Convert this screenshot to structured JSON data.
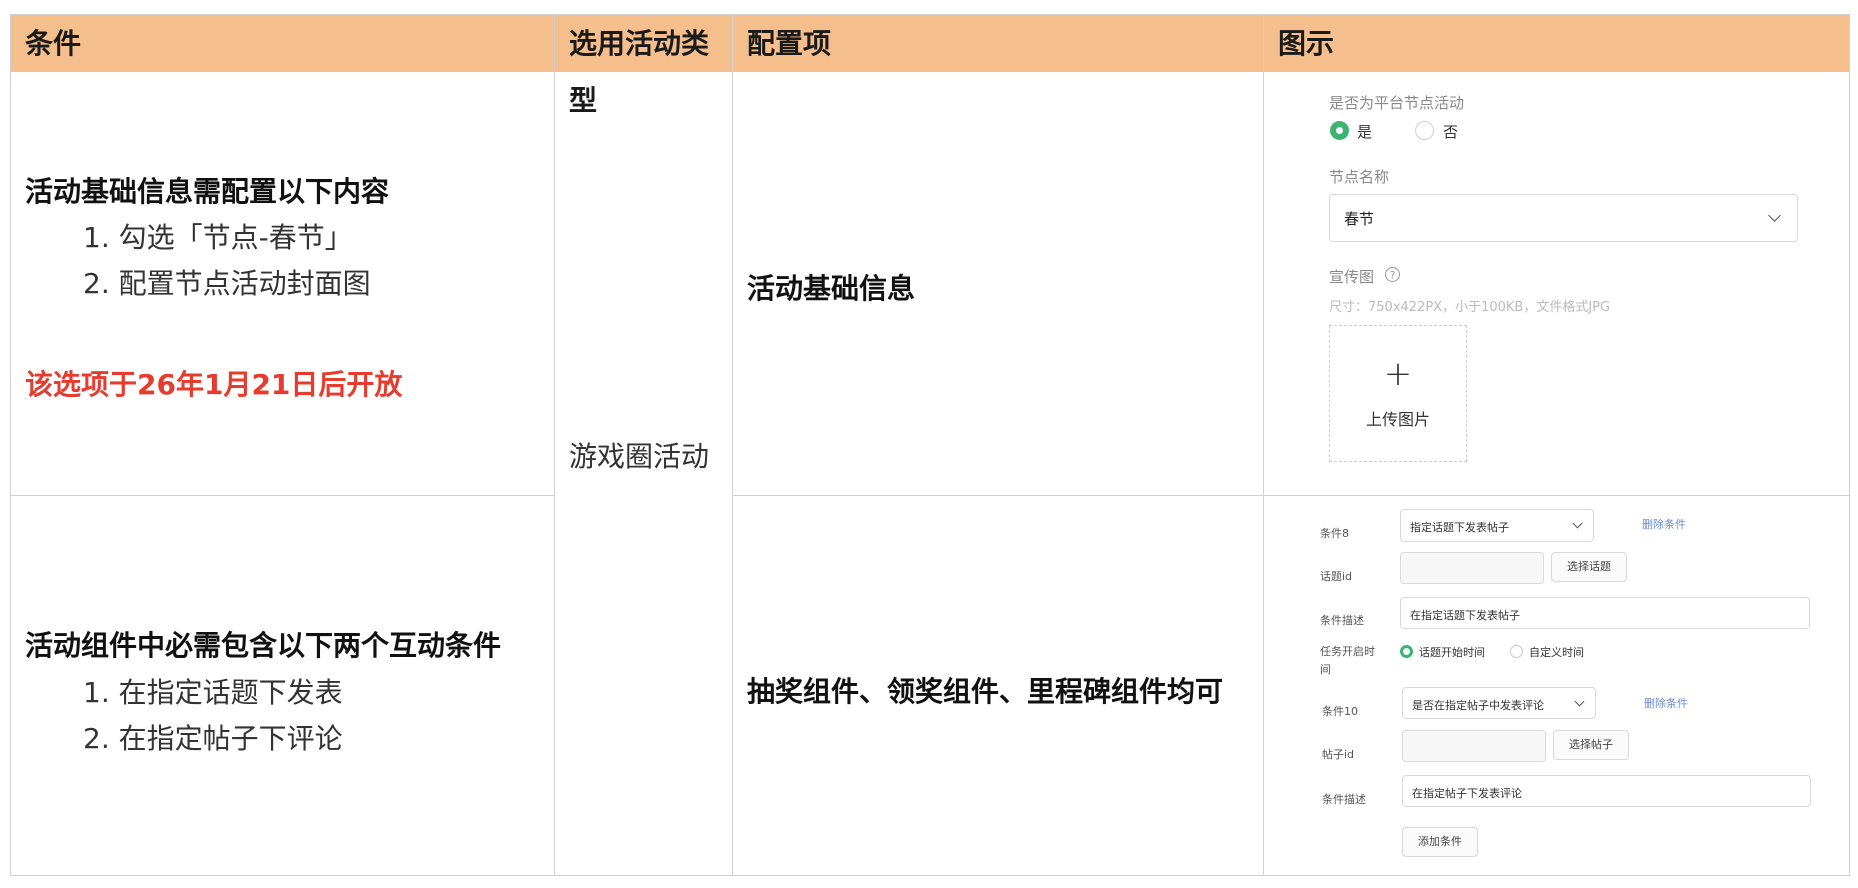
{
  "headers": {
    "condition": "条件",
    "activity_type": "选用活动类型",
    "config_item": "配置项",
    "illustration": "图示"
  },
  "row1": {
    "title": "活动基础信息需配置以下内容",
    "items": [
      "1. 勾选「节点-春节」",
      "2. 配置节点活动封面图"
    ],
    "notice": "该选项于26年1月21日后开放",
    "config": "活动基础信息"
  },
  "activity_type": "游戏圈活动",
  "row2": {
    "title": "活动组件中必需包含以下两个互动条件",
    "items": [
      "1. 在指定话题下发表",
      "2. 在指定帖子下评论"
    ],
    "config": "抽奖组件、领奖组件、里程碑组件均可"
  },
  "form1": {
    "platform_node_label": "是否为平台节点活动",
    "radio_yes": "是",
    "radio_no": "否",
    "node_name_label": "节点名称",
    "node_name_value": "春节",
    "promo_label": "宣传图",
    "promo_hint": "尺寸：750x422PX，小于100KB，文件格式JPG",
    "upload_label": "上传图片",
    "upload_plus": "+"
  },
  "form2": {
    "cond8_label": "条件8",
    "cond8_value": "指定话题下发表帖子",
    "delete1": "删除条件",
    "topic_id_label": "话题id",
    "select_topic": "选择话题",
    "desc1_label": "条件描述",
    "desc1_value": "在指定话题下发表帖子",
    "task_time_label_1": "任务开启时",
    "task_time_label_2": "间",
    "radio_topic_time": "话题开始时间",
    "radio_custom_time": "自定义时间",
    "cond10_label": "条件10",
    "cond10_value": "是否在指定帖子中发表评论",
    "delete2": "删除条件",
    "post_id_label": "帖子id",
    "select_post": "选择帖子",
    "desc2_label": "条件描述",
    "desc2_value": "在指定帖子下发表评论",
    "add_condition": "添加条件"
  },
  "colors": {
    "header_bg": "#f5be8d",
    "notice": "#e63b2e",
    "radio_checked": "#3cb371",
    "link": "#6b8bd6"
  }
}
